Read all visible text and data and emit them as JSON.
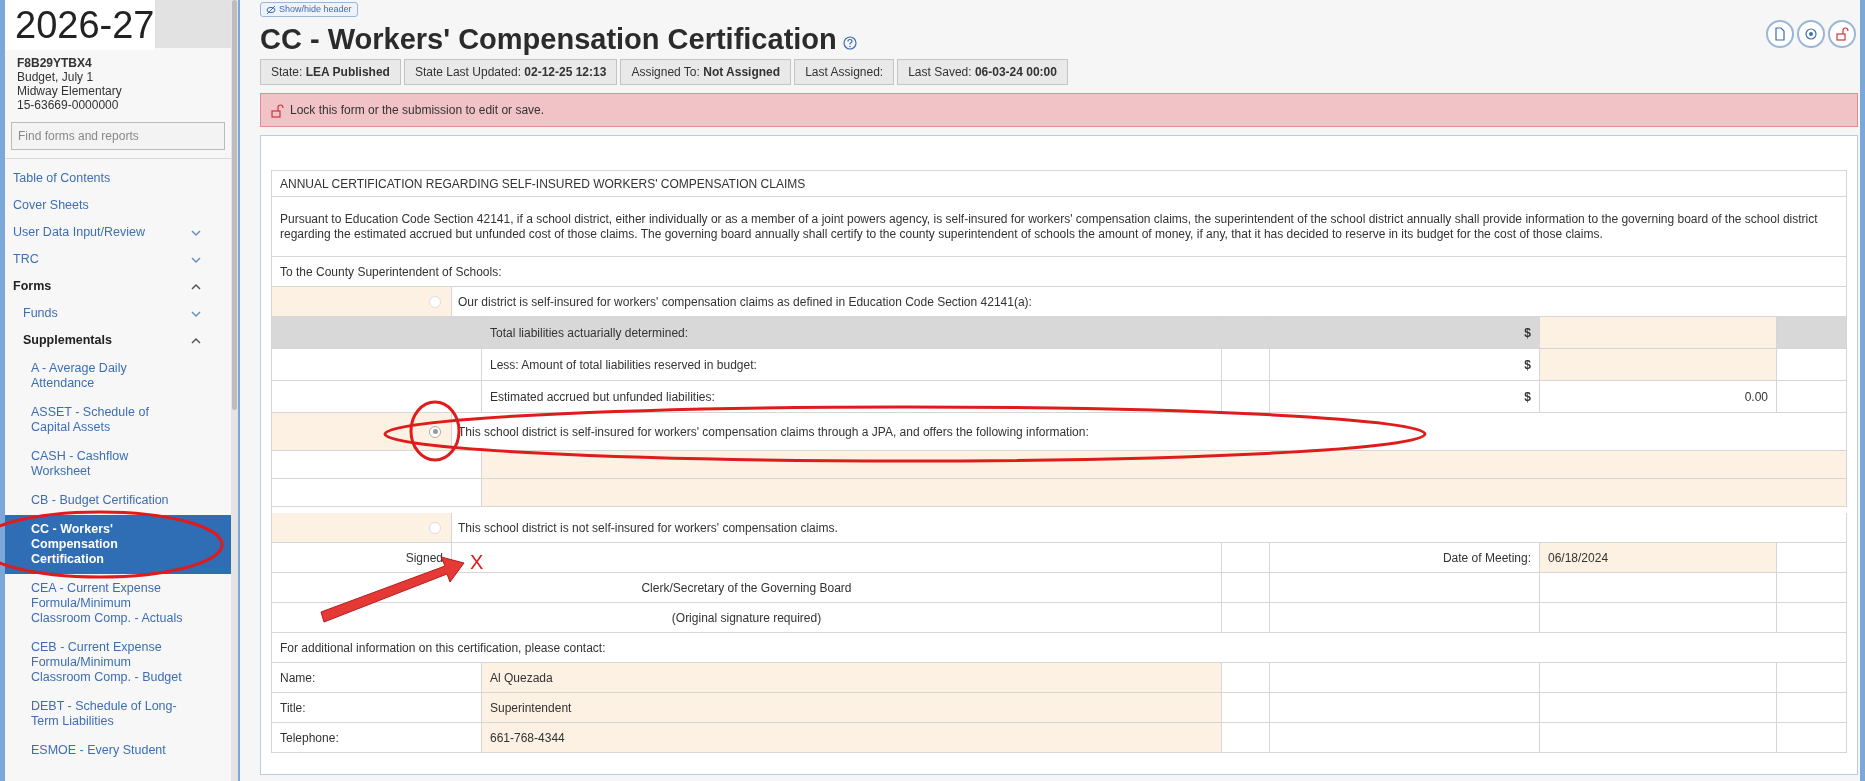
{
  "sidebar": {
    "year": "2026-27",
    "form_code": "F8B29YTBX4",
    "details": [
      "Budget, July 1",
      "Midway Elementary",
      "15-63669-0000000"
    ],
    "search": {
      "placeholder": "Find forms and reports"
    },
    "nav": [
      {
        "label": "Table of Contents",
        "kind": "link"
      },
      {
        "label": "Cover Sheets",
        "kind": "link"
      },
      {
        "label": "User Data Input/Review",
        "kind": "group",
        "expanded": false
      },
      {
        "label": "TRC",
        "kind": "group",
        "expanded": false
      },
      {
        "label": "Forms",
        "kind": "group",
        "expanded": true,
        "children": [
          {
            "label": "Funds",
            "kind": "group",
            "expanded": false
          },
          {
            "label": "Supplementals",
            "kind": "group",
            "expanded": true,
            "children": [
              {
                "label": "A - Average Daily Attendance",
                "kind": "link",
                "selected": false
              },
              {
                "label": "ASSET - Schedule of Capital Assets",
                "kind": "link",
                "selected": false
              },
              {
                "label": "CASH - Cashflow Worksheet",
                "kind": "link",
                "selected": false
              },
              {
                "label": "CB - Budget Certification",
                "kind": "link",
                "selected": false
              },
              {
                "label": "CC - Workers' Compensation Certification",
                "kind": "link",
                "selected": true
              },
              {
                "label": "CEA - Current Expense Formula/Minimum Classroom Comp. - Actuals",
                "kind": "link",
                "selected": false
              },
              {
                "label": "CEB - Current Expense Formula/Minimum Classroom Comp. - Budget",
                "kind": "link",
                "selected": false
              },
              {
                "label": "DEBT - Schedule of Long-Term Liabilities",
                "kind": "link",
                "selected": false
              },
              {
                "label": "ESMOE - Every Student",
                "kind": "link",
                "selected": false
              }
            ]
          }
        ]
      }
    ]
  },
  "header": {
    "toggle": "Show/hide header",
    "title": "CC - Workers' Compensation Certification",
    "status": [
      "State: **LEA Published**",
      "State Last Updated: **02-12-25 12:13**",
      "Assigned To: **Not Assigned**",
      "Last Assigned:",
      "Last Saved: **06-03-24 00:00**"
    ],
    "actions": [
      {
        "kind": "document"
      },
      {
        "kind": "badge"
      },
      {
        "kind": "unlock"
      }
    ],
    "banner": "Lock this form or the submission to edit or save."
  },
  "form": {
    "heading": "ANNUAL CERTIFICATION REGARDING SELF-INSURED WORKERS' COMPENSATION CLAIMS",
    "intro": "Pursuant to Education Code Section 42141, if a school district, either individually or as a member of a joint powers agency, is self-insured for workers' compensation claims, the superintendent of the school district annually shall provide information to the governing board of the school district regarding the estimated accrued but unfunded cost of those claims. The governing board annually shall certify to the county superintendent of schools the amount of money, if any, that it has decided to reserve in its budget for the cost of those claims.",
    "addressee": "To the County Superintendent of Schools:",
    "options": [
      {
        "kind": "amounts",
        "label": "Our district is self-insured for workers' compensation claims as defined in Education Code Section 42141(a):",
        "selected": false,
        "lines": [
          {
            "label": "Total liabilities actuarially determined:",
            "currency": "$",
            "highlighted": true,
            "editable": true
          },
          {
            "label": "Less: Amount of total liabilities reserved in budget:",
            "currency": "$",
            "highlighted": false,
            "editable": true
          },
          {
            "label": "Estimated accrued but unfunded liabilities:",
            "currency": "$",
            "highlighted": false,
            "editable": false,
            "value": "0.00"
          }
        ]
      },
      {
        "kind": "text_lines",
        "label": "This school district is self-insured for workers' compensation claims through a JPA, and offers the following information:",
        "selected": true
      },
      {
        "kind": "plain",
        "label": "This school district is not self-insured for workers' compensation claims.",
        "selected": false
      }
    ],
    "signature": {
      "label": "Signed",
      "date_label": "Date of Meeting:",
      "date_value": "06/18/2024",
      "signer": "Clerk/Secretary of the Governing Board",
      "note": "(Original signature required)"
    },
    "contact": {
      "intro": "For additional information on this certification, please contact:",
      "fields": [
        {
          "label": "Name:",
          "value": "Al Quezada"
        },
        {
          "label": "Title:",
          "value": "Superintendent"
        },
        {
          "label": "Telephone:",
          "value": "661-768-4344"
        }
      ]
    }
  },
  "annotations": [
    {
      "kind": "ellipse"
    },
    {
      "kind": "circle"
    },
    {
      "kind": "ellipse"
    },
    {
      "kind": "arrow"
    },
    {
      "kind": "text",
      "text": "X"
    }
  ]
}
